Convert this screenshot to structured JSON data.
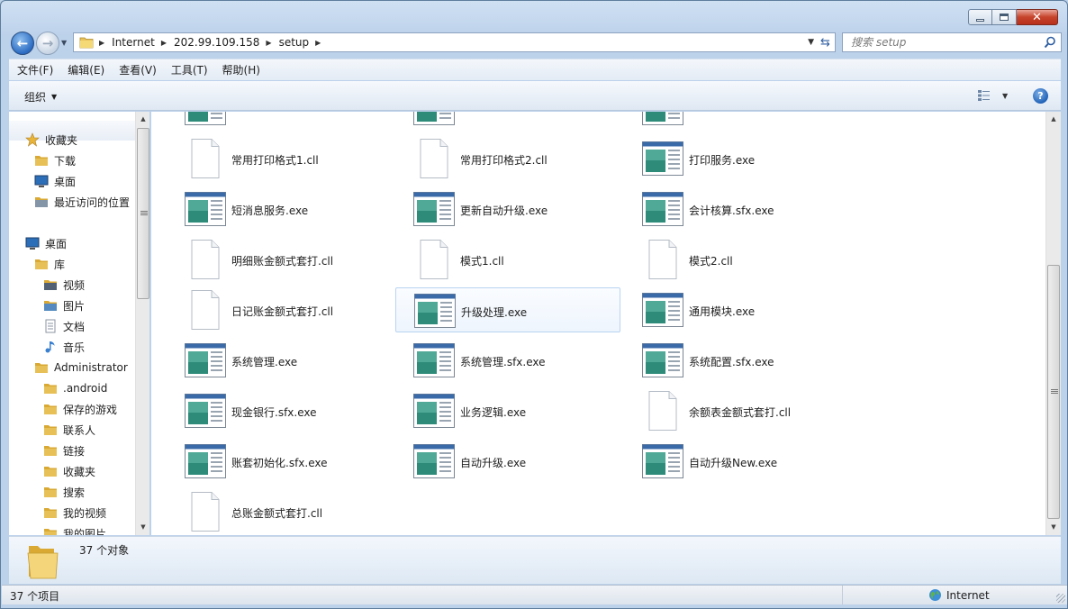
{
  "window": {
    "caption_buttons": [
      "minimize-icon",
      "maximize-icon",
      "close-icon"
    ]
  },
  "nav": {
    "breadcrumbs": [
      "Internet",
      "202.99.109.158",
      "setup"
    ],
    "search_placeholder": "搜索 setup"
  },
  "menu": {
    "items": [
      "文件(F)",
      "编辑(E)",
      "查看(V)",
      "工具(T)",
      "帮助(H)"
    ]
  },
  "command": {
    "organize_label": "组织"
  },
  "sidebar": {
    "items": [
      {
        "label": "收藏夹",
        "icon": "star-icon"
      },
      {
        "label": "下载",
        "icon": "download-folder-icon"
      },
      {
        "label": "桌面",
        "icon": "desktop-icon"
      },
      {
        "label": "最近访问的位置",
        "icon": "recent-places-icon"
      },
      {
        "label": "桌面",
        "icon": "desktop-icon"
      },
      {
        "label": "库",
        "icon": "library-icon"
      },
      {
        "label": "视频",
        "icon": "video-library-icon"
      },
      {
        "label": "图片",
        "icon": "pictures-library-icon"
      },
      {
        "label": "文档",
        "icon": "documents-library-icon"
      },
      {
        "label": "音乐",
        "icon": "music-library-icon"
      },
      {
        "label": "Administrator",
        "icon": "user-folder-icon"
      },
      {
        "label": ".android",
        "icon": "folder-icon"
      },
      {
        "label": "保存的游戏",
        "icon": "saved-games-icon"
      },
      {
        "label": "联系人",
        "icon": "contacts-icon"
      },
      {
        "label": "链接",
        "icon": "links-icon"
      },
      {
        "label": "收藏夹",
        "icon": "favorites-folder-icon"
      },
      {
        "label": "搜索",
        "icon": "searches-icon"
      },
      {
        "label": "我的视频",
        "icon": "my-videos-icon"
      },
      {
        "label": "我的图片",
        "icon": "my-pictures-icon"
      }
    ]
  },
  "files": [
    {
      "name": "常用打印格式1.cll",
      "type": "doc"
    },
    {
      "name": "常用打印格式2.cll",
      "type": "doc"
    },
    {
      "name": "打印服务.exe",
      "type": "exe"
    },
    {
      "name": "短消息服务.exe",
      "type": "exe"
    },
    {
      "name": "更新自动升级.exe",
      "type": "exe"
    },
    {
      "name": "会计核算.sfx.exe",
      "type": "exe"
    },
    {
      "name": "明细账金额式套打.cll",
      "type": "doc"
    },
    {
      "name": "模式1.cll",
      "type": "doc"
    },
    {
      "name": "模式2.cll",
      "type": "doc"
    },
    {
      "name": "日记账金额式套打.cll",
      "type": "doc"
    },
    {
      "name": "升级处理.exe",
      "type": "exe",
      "selected": true
    },
    {
      "name": "通用模块.exe",
      "type": "exe"
    },
    {
      "name": "系统管理.exe",
      "type": "exe"
    },
    {
      "name": "系统管理.sfx.exe",
      "type": "exe"
    },
    {
      "name": "系统配置.sfx.exe",
      "type": "exe"
    },
    {
      "name": "现金银行.sfx.exe",
      "type": "exe"
    },
    {
      "name": "业务逻辑.exe",
      "type": "exe"
    },
    {
      "name": "余额表金额式套打.cll",
      "type": "doc"
    },
    {
      "name": "账套初始化.sfx.exe",
      "type": "exe"
    },
    {
      "name": "自动升级.exe",
      "type": "exe"
    },
    {
      "name": "自动升级New.exe",
      "type": "exe"
    },
    {
      "name": "总账金额式套打.cll",
      "type": "doc"
    }
  ],
  "details": {
    "count_text": "37 个对象"
  },
  "status": {
    "items_text": "37 个项目",
    "zone_text": "Internet"
  },
  "colors": {
    "window_frame": "#bcd1ea",
    "selection_border": "#b9d4f2",
    "close_button": "#c7432b"
  }
}
